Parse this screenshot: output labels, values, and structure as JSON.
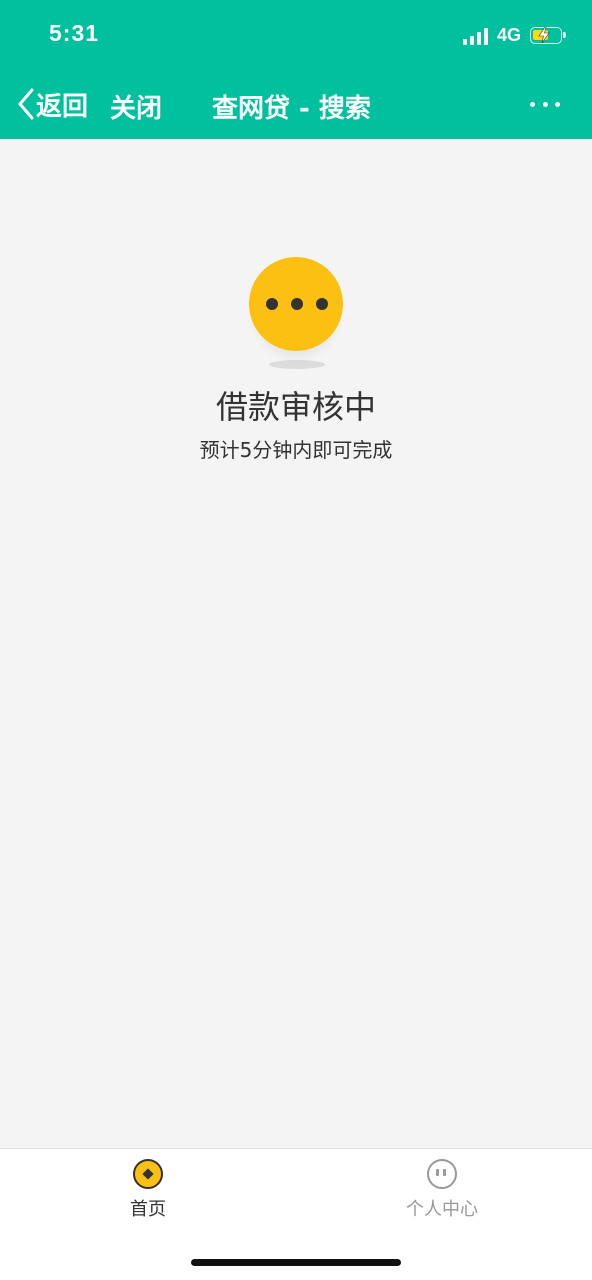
{
  "status_bar": {
    "time": "5:31",
    "network": "4G"
  },
  "nav": {
    "back_label": "返回",
    "close_label": "关闭",
    "title": "查网贷 - 搜索"
  },
  "main": {
    "status_title": "借款审核中",
    "status_subtitle": "预计5分钟内即可完成"
  },
  "tab_bar": {
    "tabs": [
      {
        "label": "首页",
        "icon": "home-coin-icon",
        "active": true
      },
      {
        "label": "个人中心",
        "icon": "profile-face-icon",
        "active": false
      }
    ]
  },
  "colors": {
    "brand_green": "#00c09d",
    "accent_yellow": "#fcc012",
    "page_background": "#f4f4f4"
  }
}
